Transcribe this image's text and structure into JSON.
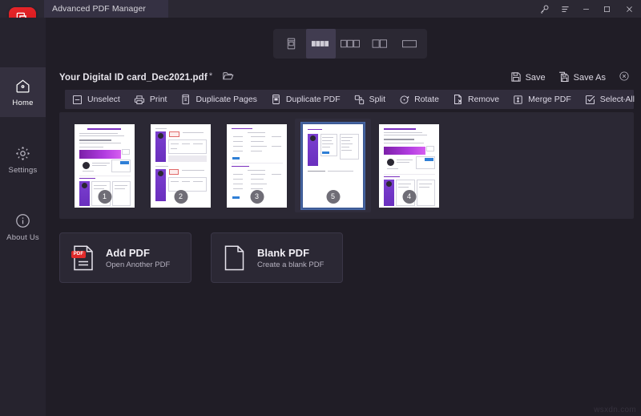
{
  "window": {
    "title": "Advanced PDF Manager",
    "logo_icon": "pdf-pages-icon",
    "controls": [
      {
        "name": "key-icon",
        "glyph": "key"
      },
      {
        "name": "menu-icon",
        "glyph": "menu"
      },
      {
        "name": "minimize-icon",
        "glyph": "minimize"
      },
      {
        "name": "maximize-icon",
        "glyph": "maximize"
      },
      {
        "name": "close-icon",
        "glyph": "close"
      }
    ]
  },
  "sidebar": {
    "items": [
      {
        "label": "Home",
        "icon": "home-icon",
        "active": true
      },
      {
        "label": "Settings",
        "icon": "gear-icon",
        "active": false
      },
      {
        "label": "About Us",
        "icon": "info-icon",
        "active": false
      }
    ]
  },
  "view_modes": [
    {
      "name": "view-mode-single-scroll",
      "icon": "single-page-scroll-icon",
      "active": false
    },
    {
      "name": "view-mode-grid-four",
      "icon": "four-column-grid-icon",
      "active": true
    },
    {
      "name": "view-mode-three-up",
      "icon": "three-panel-icon",
      "active": false
    },
    {
      "name": "view-mode-two-up",
      "icon": "two-panel-icon",
      "active": false
    },
    {
      "name": "view-mode-one-up",
      "icon": "one-panel-icon",
      "active": false
    }
  ],
  "document": {
    "filename": "Your Digital ID card_Dec2021.pdf",
    "modified_marker": "*",
    "open_folder_icon": "folder-open-icon",
    "save_label": "Save",
    "save_icon": "floppy-disk-icon",
    "save_as_label": "Save As",
    "save_as_icon": "floppy-disk-copy-icon",
    "close_doc_icon": "close-circle-icon"
  },
  "toolbar": {
    "items": [
      {
        "label": "Unselect",
        "icon": "unselect-icon"
      },
      {
        "label": "Print",
        "icon": "printer-icon"
      },
      {
        "label": "Duplicate Pages",
        "icon": "duplicate-pages-icon"
      },
      {
        "label": "Duplicate PDF",
        "icon": "duplicate-pdf-icon"
      },
      {
        "label": "Split",
        "icon": "split-icon"
      },
      {
        "label": "Rotate",
        "icon": "rotate-icon"
      },
      {
        "label": "Remove",
        "icon": "remove-icon"
      },
      {
        "label": "Merge PDF",
        "icon": "merge-pdf-icon"
      },
      {
        "label": "Select All",
        "icon": "select-all-checkbox-icon"
      }
    ],
    "overflow_icon": "overflow-ellipsis-icon"
  },
  "thumbnails": [
    {
      "page": "1",
      "selected": false,
      "style": "cover"
    },
    {
      "page": "2",
      "selected": false,
      "style": "form"
    },
    {
      "page": "3",
      "selected": false,
      "style": "list"
    },
    {
      "page": "5",
      "selected": true,
      "style": "panel"
    },
    {
      "page": "4",
      "selected": false,
      "style": "cover"
    }
  ],
  "cards": [
    {
      "title": "Add PDF",
      "subtitle": "Open Another PDF",
      "icon": "pdf-file-add-icon",
      "badge": "PDF"
    },
    {
      "title": "Blank PDF",
      "subtitle": "Create a blank PDF",
      "icon": "blank-page-icon",
      "badge": ""
    }
  ],
  "watermark": "wsxdn.com",
  "colors": {
    "app_bg": "#201d26",
    "titlebar_bg": "#2b2833",
    "sidebar_bg": "#26232e",
    "panel_bg": "#2b2834",
    "toolbar_bg": "#312d3c",
    "accent_red": "#e8262a",
    "selection_blue": "#3e5b96",
    "doc_purple": "#7b3fd0"
  }
}
